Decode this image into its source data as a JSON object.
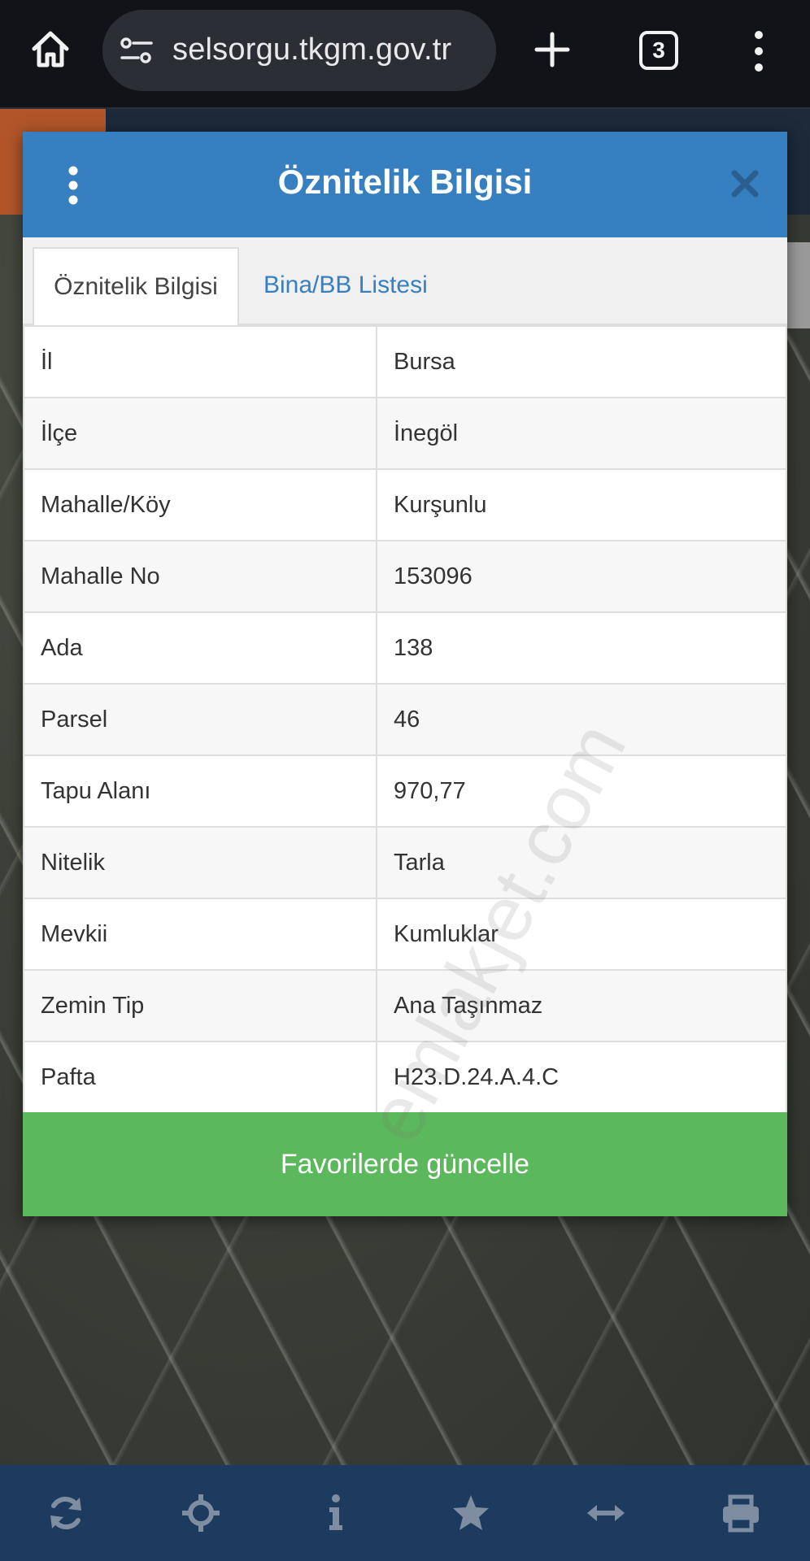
{
  "browser": {
    "url": "selsorgu.tkgm.gov.tr",
    "tab_count": "3"
  },
  "modal": {
    "title": "Öznitelik Bilgisi",
    "tabs": [
      {
        "label": "Öznitelik Bilgisi",
        "active": true
      },
      {
        "label": "Bina/BB Listesi",
        "active": false
      }
    ],
    "rows": [
      {
        "key": "İl",
        "value": "Bursa"
      },
      {
        "key": "İlçe",
        "value": "İnegöl"
      },
      {
        "key": "Mahalle/Köy",
        "value": "Kurşunlu"
      },
      {
        "key": "Mahalle No",
        "value": "153096"
      },
      {
        "key": "Ada",
        "value": "138"
      },
      {
        "key": "Parsel",
        "value": "46"
      },
      {
        "key": "Tapu Alanı",
        "value": "970,77"
      },
      {
        "key": "Nitelik",
        "value": "Tarla"
      },
      {
        "key": "Mevkii",
        "value": "Kumluklar"
      },
      {
        "key": "Zemin Tip",
        "value": "Ana Taşınmaz"
      },
      {
        "key": "Pafta",
        "value": "H23.D.24.A.4.C"
      }
    ],
    "update_button": "Favorilerde güncelle"
  },
  "watermark": "emlakjet.com",
  "toolbar": {
    "icons": [
      "refresh-icon",
      "locate-icon",
      "info-icon",
      "star-icon",
      "measure-icon",
      "print-icon"
    ]
  },
  "colors": {
    "header_blue": "#367fc0",
    "button_green": "#5cb85c",
    "toolbar_navy": "#1d3a5f"
  }
}
